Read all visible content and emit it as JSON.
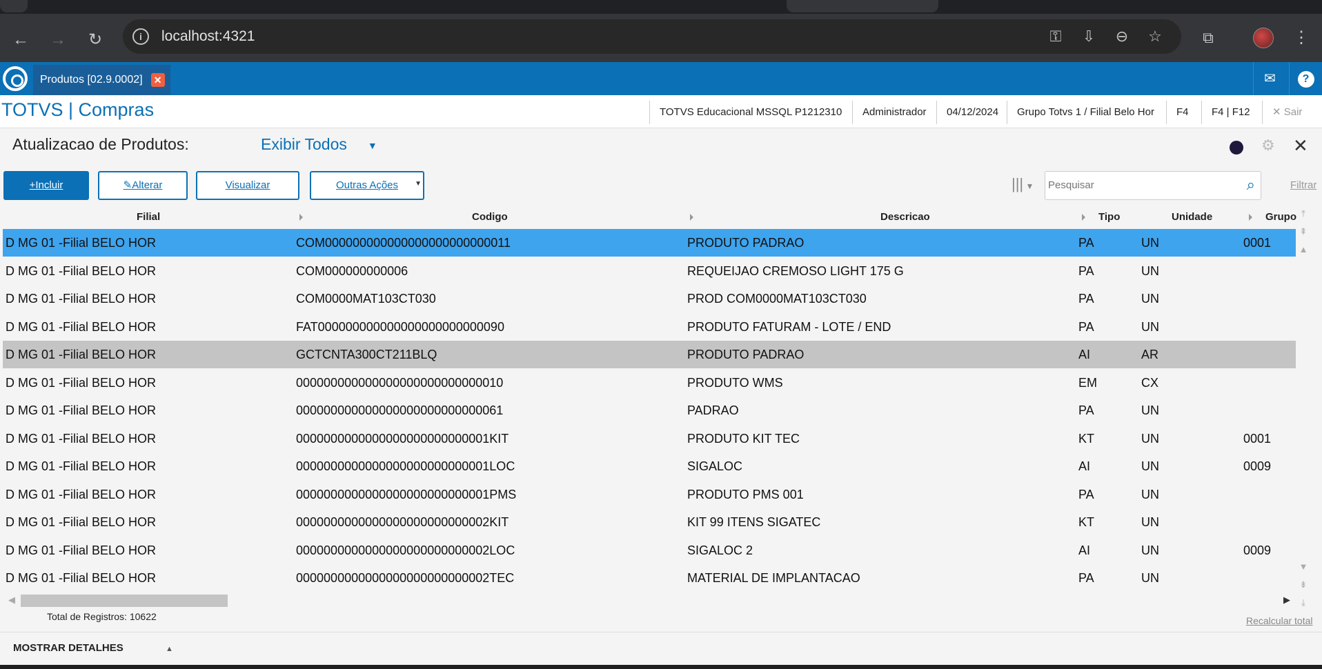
{
  "browser": {
    "url": "localhost:4321"
  },
  "app_tab": {
    "label": "Produtos [02.9.0002]",
    "close": "✕"
  },
  "header": {
    "brand": "TOTVS | Compras",
    "environment": "TOTVS Educacional MSSQL P1212310",
    "user": "Administrador",
    "date": "04/12/2024",
    "branch": "Grupo Totvs 1 / Filial Belo Hor",
    "f4": "F4",
    "f4f12": "F4 | F12",
    "exit": "✕ Sair"
  },
  "page": {
    "title": "Atualizacao de Produtos:",
    "view_filter": "Exibir Todos"
  },
  "toolbar": {
    "include": "Incluir",
    "edit": "Alterar",
    "view": "Visualizar",
    "other_actions": "Outras Ações",
    "search_placeholder": "Pesquisar",
    "filter": "Filtrar"
  },
  "grid": {
    "columns": [
      "Filial",
      "Codigo",
      "Descricao",
      "Tipo",
      "Unidade",
      "Grupo"
    ],
    "rows": [
      {
        "filial": "D MG 01 -Filial BELO HOR",
        "codigo": "COM000000000000000000000000011",
        "descricao": "PRODUTO PADRAO",
        "tipo": "PA",
        "unidade": "UN",
        "grupo": "0001"
      },
      {
        "filial": "D MG 01 -Filial BELO HOR",
        "codigo": "COM000000000006",
        "descricao": "REQUEIJAO CREMOSO LIGHT 175 G",
        "tipo": "PA",
        "unidade": "UN",
        "grupo": ""
      },
      {
        "filial": "D MG 01 -Filial BELO HOR",
        "codigo": "COM0000MAT103CT030",
        "descricao": "PROD COM0000MAT103CT030",
        "tipo": "PA",
        "unidade": "UN",
        "grupo": ""
      },
      {
        "filial": "D MG 01 -Filial BELO HOR",
        "codigo": "FAT000000000000000000000000090",
        "descricao": "PRODUTO FATURAM - LOTE / END",
        "tipo": "PA",
        "unidade": "UN",
        "grupo": ""
      },
      {
        "filial": "D MG 01 -Filial BELO HOR",
        "codigo": "GCTCNTA300CT211BLQ",
        "descricao": "PRODUTO PADRAO",
        "tipo": "AI",
        "unidade": "AR",
        "grupo": ""
      },
      {
        "filial": "D MG 01 -Filial BELO HOR",
        "codigo": "000000000000000000000000000010",
        "descricao": "PRODUTO WMS",
        "tipo": "EM",
        "unidade": "CX",
        "grupo": ""
      },
      {
        "filial": "D MG 01 -Filial BELO HOR",
        "codigo": "000000000000000000000000000061",
        "descricao": "PADRAO",
        "tipo": "PA",
        "unidade": "UN",
        "grupo": ""
      },
      {
        "filial": "D MG 01 -Filial BELO HOR",
        "codigo": "0000000000000000000000000001KIT",
        "descricao": "PRODUTO KIT TEC",
        "tipo": "KT",
        "unidade": "UN",
        "grupo": "0001"
      },
      {
        "filial": "D MG 01 -Filial BELO HOR",
        "codigo": "0000000000000000000000000001LOC",
        "descricao": "SIGALOC",
        "tipo": "AI",
        "unidade": "UN",
        "grupo": "0009"
      },
      {
        "filial": "D MG 01 -Filial BELO HOR",
        "codigo": "0000000000000000000000000001PMS",
        "descricao": "PRODUTO PMS 001",
        "tipo": "PA",
        "unidade": "UN",
        "grupo": ""
      },
      {
        "filial": "D MG 01 -Filial BELO HOR",
        "codigo": "0000000000000000000000000002KIT",
        "descricao": "KIT 99 ITENS SIGATEC",
        "tipo": "KT",
        "unidade": "UN",
        "grupo": ""
      },
      {
        "filial": "D MG 01 -Filial BELO HOR",
        "codigo": "0000000000000000000000000002LOC",
        "descricao": "SIGALOC 2",
        "tipo": "AI",
        "unidade": "UN",
        "grupo": "0009"
      },
      {
        "filial": "D MG 01 -Filial BELO HOR",
        "codigo": "0000000000000000000000000002TEC",
        "descricao": "MATERIAL DE IMPLANTACAO",
        "tipo": "PA",
        "unidade": "UN",
        "grupo": ""
      }
    ],
    "selected_row": 0,
    "highlighted_row": 4
  },
  "footer": {
    "total": "Total de Registros: 10622",
    "recalc": "Recalcular total",
    "details": "MOSTRAR DETALHES"
  },
  "colors": {
    "brand_blue": "#0b70b5",
    "selected_row": "#3ea4ee",
    "highlight_row": "#c4c4c4"
  }
}
